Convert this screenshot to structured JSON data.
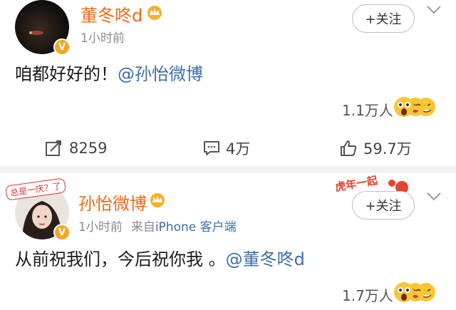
{
  "posts": [
    {
      "username": "董冬咚d",
      "meta_time": "1小时前",
      "meta_source": "",
      "meta_device": "",
      "follow_label": "+关注",
      "content": "咱都好好的！",
      "mention": "@孙怡微博",
      "likes_text": "1.1万人"
    },
    {
      "username": "孙怡微博",
      "meta_time": "1小时前",
      "meta_source": "来自",
      "meta_device": "iPhone 客户端",
      "follow_label": "+关注",
      "content": "从前祝我们，今后祝你我 。",
      "mention": "@董冬咚d",
      "likes_text": "1.7万人"
    }
  ],
  "actions": {
    "repost_count": "8259",
    "comment_count": "4万",
    "like_count": "59.7万"
  },
  "avatar2_sticker_text": "总是一庆？了",
  "header_sticker_text": "虎年一起"
}
